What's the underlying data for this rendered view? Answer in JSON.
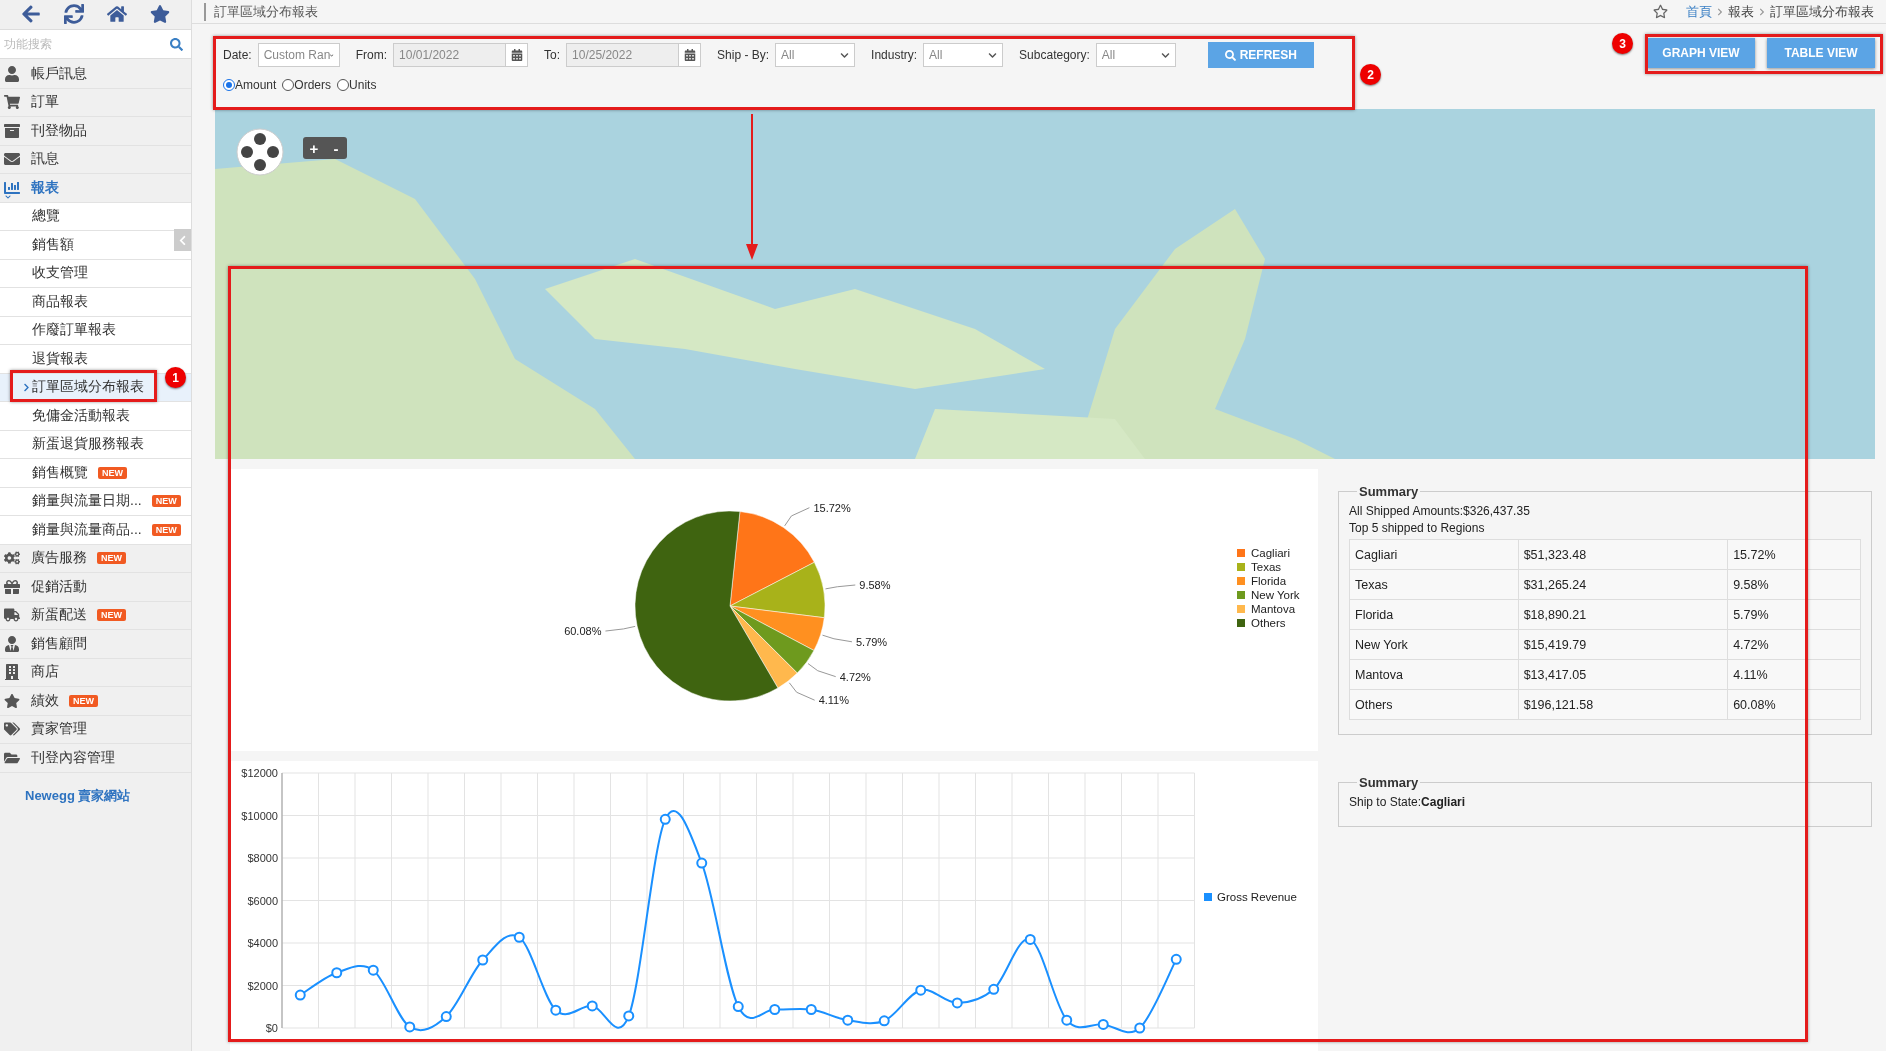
{
  "sidebar": {
    "search": {
      "placeholder": "功能搜索"
    },
    "items": [
      {
        "label": "帳戶訊息",
        "selected": false
      },
      {
        "label": "訂單",
        "selected": false
      },
      {
        "label": "刊登物品",
        "selected": false
      },
      {
        "label": "訊息",
        "selected": false
      },
      {
        "label": "報表",
        "selected": true,
        "expanded": true,
        "children": [
          {
            "label": "總覽",
            "selected": false
          },
          {
            "label": "銷售額",
            "selected": false
          },
          {
            "label": "收支管理",
            "selected": false
          },
          {
            "label": "商品報表",
            "selected": false
          },
          {
            "label": "作廢訂單報表",
            "selected": false
          },
          {
            "label": "退貨報表",
            "selected": false
          },
          {
            "label": "訂單區域分布報表",
            "selected": true
          },
          {
            "label": "免傭金活動報表",
            "selected": false
          },
          {
            "label": "新蛋退貨服務報表",
            "selected": false
          },
          {
            "label": "銷售概覽",
            "badge": "NEW",
            "selected": false
          },
          {
            "label": "銷量與流量日期...",
            "badge": "NEW",
            "selected": false
          },
          {
            "label": "銷量與流量商品...",
            "badge": "NEW",
            "selected": false
          }
        ]
      },
      {
        "label": "廣告服務",
        "badge": "NEW",
        "selected": false
      },
      {
        "label": "促銷活動",
        "selected": false
      },
      {
        "label": "新蛋配送",
        "badge": "NEW",
        "selected": false
      },
      {
        "label": "銷售顧問",
        "selected": false
      },
      {
        "label": "商店",
        "selected": false
      },
      {
        "label": "績效",
        "badge": "NEW",
        "selected": false
      },
      {
        "label": "賣家管理",
        "selected": false
      },
      {
        "label": "刊登內容管理",
        "selected": false
      }
    ],
    "footer_link": "Newegg 賣家網站"
  },
  "header": {
    "title": "訂單區域分布報表",
    "breadcrumb": [
      "首頁",
      "報表",
      "訂單區域分布報表"
    ]
  },
  "filters": {
    "fields": [
      {
        "kind": "select",
        "label": "Date:",
        "value": "Custom Ran"
      },
      {
        "kind": "date",
        "label": "From:",
        "value": "10/01/2022"
      },
      {
        "kind": "date",
        "label": "To:",
        "value": "10/25/2022"
      },
      {
        "kind": "select",
        "label": "Ship - By:",
        "value": "All"
      },
      {
        "kind": "select",
        "label": "Industry:",
        "value": "All"
      },
      {
        "kind": "select",
        "label": "Subcategory:",
        "value": "All"
      }
    ],
    "refresh_button": "REFRESH",
    "measures": [
      {
        "label": "Amount",
        "selected": true
      },
      {
        "label": "Orders",
        "selected": false
      },
      {
        "label": "Units",
        "selected": false
      }
    ]
  },
  "view_buttons": [
    "GRAPH VIEW",
    "TABLE VIEW"
  ],
  "map": {
    "zoom_in": "+",
    "zoom_out": "-"
  },
  "pie": {
    "chart_data": {
      "type": "pie",
      "categories": [
        "Cagliari",
        "Texas",
        "Florida",
        "New York",
        "Mantova",
        "Others"
      ],
      "values": [
        15.72,
        9.58,
        5.79,
        4.72,
        4.11,
        60.08
      ],
      "value_labels": [
        "15.72%",
        "9.58%",
        "5.79%",
        "4.72%",
        "4.11%",
        "60.08%"
      ],
      "legend": "right",
      "colors": [
        "#ff7518",
        "#a8b21a",
        "#ff9020",
        "#6e9a1e",
        "#ffb84d",
        "#3f6410"
      ],
      "data_labels": true
    }
  },
  "line": {
    "chart_data": {
      "type": "line",
      "ylim": [
        0,
        12000
      ],
      "yticks": [
        {
          "value": 0,
          "label": "$0"
        },
        {
          "value": 2000,
          "label": "$2000"
        },
        {
          "value": 4000,
          "label": "$4000"
        },
        {
          "value": 6000,
          "label": "$6000"
        },
        {
          "value": 8000,
          "label": "$8000"
        },
        {
          "value": 10000,
          "label": "$10000"
        },
        {
          "value": 12000,
          "label": "$12000"
        }
      ],
      "grid": true,
      "legend": "right",
      "series": [
        {
          "name": "Gross Revenue",
          "color": "#1a90ff",
          "marker": "circle",
          "values": [
            1550,
            2600,
            2720,
            50,
            540,
            3200,
            4270,
            840,
            1040,
            570,
            9820,
            7760,
            1010,
            870,
            870,
            370,
            340,
            1780,
            1180,
            1820,
            4170,
            370,
            170,
            0,
            3230
          ]
        }
      ]
    }
  },
  "summary": {
    "title": "Summary",
    "total": "All Shipped Amounts:$326,437.35",
    "subtitle": "Top 5 shipped to Regions",
    "rows": [
      [
        "Cagliari",
        "$51,323.48",
        "15.72%"
      ],
      [
        "Texas",
        "$31,265.24",
        "9.58%"
      ],
      [
        "Florida",
        "$18,890.21",
        "5.79%"
      ],
      [
        "New York",
        "$15,419.79",
        "4.72%"
      ],
      [
        "Mantova",
        "$13,417.05",
        "4.11%"
      ],
      [
        "Others",
        "$196,121.58",
        "60.08%"
      ]
    ]
  },
  "state_summary": {
    "title": "Summary",
    "text": "Ship to State:**Cagliari**"
  },
  "annotations": [
    "1",
    "2",
    "3"
  ]
}
